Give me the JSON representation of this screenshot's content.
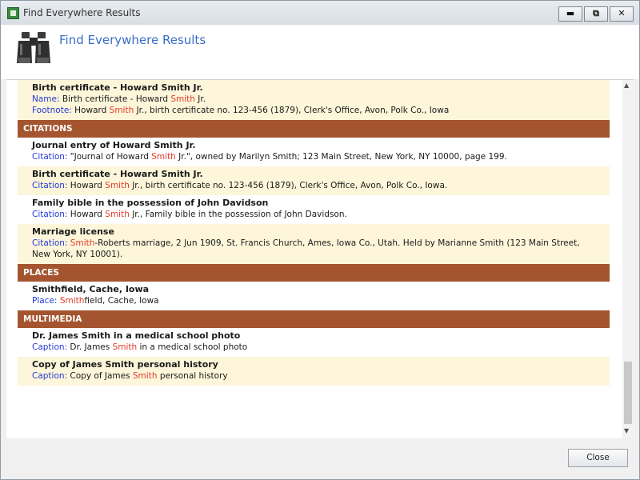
{
  "window": {
    "title": "Find Everywhere Results",
    "buttons": {
      "minimize": "▬",
      "restore": "⧉",
      "close": "✕"
    }
  },
  "header": {
    "title": "Find Everywhere Results",
    "icon": "binoculars-icon"
  },
  "top_row": {
    "title": "Birth certificate - Howard Smith Jr.",
    "lines": [
      {
        "label": "Name:",
        "pre": " Birth certificate - Howard ",
        "hl": "Smith",
        "post": " Jr."
      },
      {
        "label": "Footnote:",
        "pre": " Howard ",
        "hl": "Smith",
        "post": " Jr., birth certificate no. 123-456 (1879), Clerk's Office, Avon, Polk Co., Iowa"
      }
    ]
  },
  "sections": [
    {
      "name": "CITATIONS",
      "rows": [
        {
          "title": "Journal entry of Howard Smith Jr.",
          "lines": [
            {
              "label": "Citation:",
              "pre": " \"Journal of Howard ",
              "hl": "Smith",
              "post": " Jr.\", owned by Marilyn Smith; 123 Main Street, New York, NY 10000, page 199."
            }
          ]
        },
        {
          "title": "Birth certificate - Howard Smith Jr.",
          "lines": [
            {
              "label": "Citation:",
              "pre": " Howard ",
              "hl": "Smith",
              "post": " Jr., birth certificate no. 123-456 (1879), Clerk's Office, Avon, Polk Co., Iowa."
            }
          ]
        },
        {
          "title": "Family bible in the possession of John Davidson",
          "lines": [
            {
              "label": "Citation:",
              "pre": " Howard ",
              "hl": "Smith",
              "post": " Jr., Family bible in the possession of John Davidson."
            }
          ]
        },
        {
          "title": "Marriage license",
          "lines": [
            {
              "label": "Citation:",
              "pre": " ",
              "hl": "Smith",
              "post": "-Roberts marriage, 2 Jun 1909, St. Francis Church, Ames, Iowa Co., Utah. Held by Marianne Smith (123 Main Street,"
            },
            {
              "label": "",
              "pre": "New York, NY 10001).",
              "hl": "",
              "post": ""
            }
          ]
        }
      ]
    },
    {
      "name": "PLACES",
      "rows": [
        {
          "title": "Smithfield, Cache, Iowa",
          "lines": [
            {
              "label": "Place:",
              "pre": " ",
              "hl": "Smith",
              "post": "field, Cache, Iowa"
            }
          ]
        }
      ]
    },
    {
      "name": "MULTIMEDIA",
      "rows": [
        {
          "title": "Dr. James Smith in a medical school photo",
          "lines": [
            {
              "label": "Caption:",
              "pre": " Dr. James ",
              "hl": "Smith",
              "post": " in a medical school photo"
            }
          ]
        },
        {
          "title": "Copy of James Smith personal history",
          "lines": [
            {
              "label": "Caption:",
              "pre": " Copy of James ",
              "hl": "Smith",
              "post": " personal history"
            }
          ]
        }
      ]
    }
  ],
  "scrollbar": {
    "up": "▲",
    "down": "▼"
  },
  "footer": {
    "close_label": "Close"
  },
  "colors": {
    "section_bg": "#a4552f",
    "row_bg": "#fdf6da",
    "label": "#2338d8",
    "highlight": "#e23a2a",
    "title": "#3b6ec8"
  }
}
